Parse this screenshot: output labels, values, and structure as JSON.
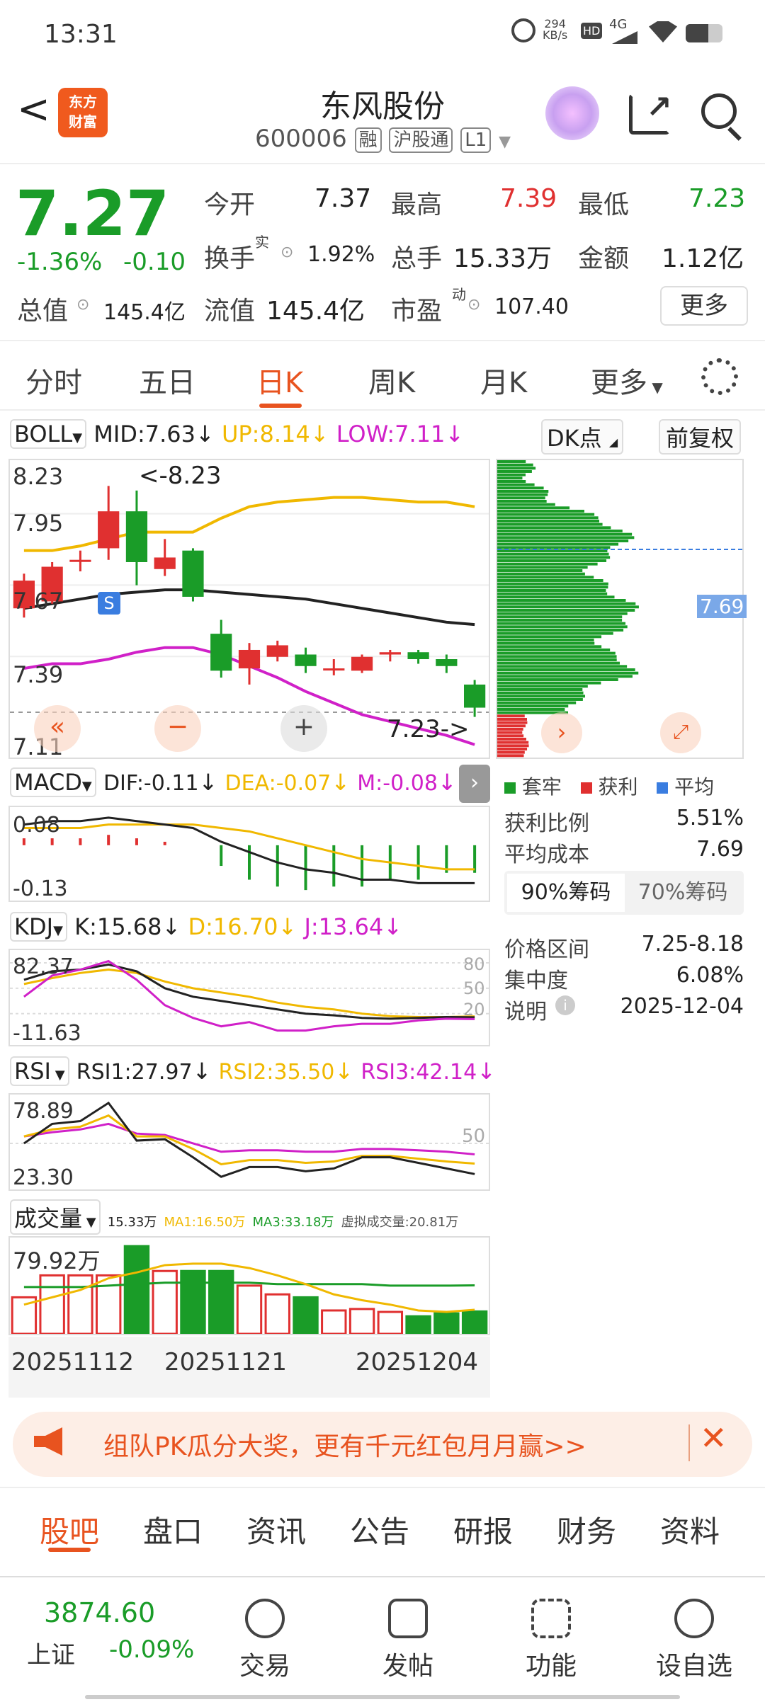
{
  "status": {
    "time": "13:31",
    "net_speed": "294",
    "net_unit": "KB/s",
    "hd": "HD",
    "signal": "4G"
  },
  "header": {
    "back": "<",
    "logo_line1": "东方",
    "logo_line2": "财富",
    "name": "东风股份",
    "code": "600006",
    "tag_rong": "融",
    "tag_hgt": "沪股通",
    "tag_level": "L1"
  },
  "quote": {
    "price": "7.27",
    "change_pct": "-1.36%",
    "change": "-0.10",
    "open_label": "今开",
    "open": "7.37",
    "high_label": "最高",
    "high": "7.39",
    "low_label": "最低",
    "low": "7.23",
    "turnover_label": "换手",
    "turnover_sup": "实",
    "turnover": "1.92%",
    "volume_label": "总手",
    "volume": "15.33万",
    "amount_label": "金额",
    "amount": "1.12亿",
    "total_cap_label": "总值",
    "total_cap": "145.4亿",
    "float_cap_label": "流值",
    "float_cap": "145.4亿",
    "pe_label": "市盈",
    "pe_sup": "动",
    "pe": "107.40",
    "more": "更多"
  },
  "tabs": [
    "分时",
    "五日",
    "日K",
    "周K",
    "月K",
    "更多"
  ],
  "boll": {
    "selector": "BOLL",
    "mid": "MID:7.63",
    "up": "UP:8.14",
    "low": "LOW:7.11",
    "arrow": "↓"
  },
  "kline": {
    "axis": [
      "8.23",
      "7.95",
      "7.67",
      "7.39",
      "7.11"
    ],
    "max_label": "<-8.23",
    "min_label": "7.23->",
    "s_mark": "S",
    "candles": [
      {
        "o": 7.7,
        "c": 7.82,
        "h": 7.85,
        "l": 7.66
      },
      {
        "o": 7.73,
        "c": 7.88,
        "h": 7.9,
        "l": 7.72
      },
      {
        "o": 7.91,
        "c": 7.91,
        "h": 7.95,
        "l": 7.86
      },
      {
        "o": 7.96,
        "c": 8.12,
        "h": 8.23,
        "l": 7.91
      },
      {
        "o": 8.12,
        "c": 7.9,
        "h": 8.21,
        "l": 7.8
      },
      {
        "o": 7.87,
        "c": 7.92,
        "h": 8.0,
        "l": 7.84
      },
      {
        "o": 7.95,
        "c": 7.75,
        "h": 7.96,
        "l": 7.73
      },
      {
        "o": 7.59,
        "c": 7.43,
        "h": 7.65,
        "l": 7.4
      },
      {
        "o": 7.44,
        "c": 7.52,
        "h": 7.55,
        "l": 7.37
      },
      {
        "o": 7.49,
        "c": 7.54,
        "h": 7.56,
        "l": 7.47
      },
      {
        "o": 7.5,
        "c": 7.45,
        "h": 7.53,
        "l": 7.42
      },
      {
        "o": 7.44,
        "c": 7.44,
        "h": 7.48,
        "l": 7.41
      },
      {
        "o": 7.43,
        "c": 7.49,
        "h": 7.5,
        "l": 7.42
      },
      {
        "o": 7.5,
        "c": 7.51,
        "h": 7.52,
        "l": 7.47
      },
      {
        "o": 7.51,
        "c": 7.48,
        "h": 7.52,
        "l": 7.46
      },
      {
        "o": 7.48,
        "c": 7.45,
        "h": 7.5,
        "l": 7.42
      },
      {
        "o": 7.37,
        "c": 7.27,
        "h": 7.39,
        "l": 7.23
      }
    ],
    "up_line": [
      7.95,
      7.95,
      7.97,
      8.0,
      8.03,
      8.03,
      8.03,
      8.09,
      8.14,
      8.16,
      8.17,
      8.18,
      8.18,
      8.17,
      8.16,
      8.16,
      8.14
    ],
    "mid_line": [
      7.7,
      7.72,
      7.74,
      7.76,
      7.77,
      7.78,
      7.78,
      7.77,
      7.76,
      7.75,
      7.74,
      7.72,
      7.7,
      7.68,
      7.66,
      7.64,
      7.63
    ],
    "low_line": [
      7.44,
      7.46,
      7.46,
      7.48,
      7.51,
      7.53,
      7.53,
      7.5,
      7.45,
      7.4,
      7.34,
      7.29,
      7.24,
      7.21,
      7.18,
      7.15,
      7.11
    ]
  },
  "macd": {
    "selector": "MACD",
    "dif": "DIF:-0.11",
    "dea": "DEA:-0.07",
    "m": "M:-0.08",
    "axis": [
      "0.08",
      "-0.13"
    ],
    "dif_line": [
      0.06,
      0.07,
      0.07,
      0.08,
      0.07,
      0.06,
      0.05,
      0.01,
      -0.02,
      -0.05,
      -0.07,
      -0.08,
      -0.1,
      -0.1,
      -0.11,
      -0.11,
      -0.11
    ],
    "dea_line": [
      0.05,
      0.05,
      0.05,
      0.06,
      0.06,
      0.06,
      0.06,
      0.05,
      0.04,
      0.02,
      0.0,
      -0.02,
      -0.04,
      -0.05,
      -0.06,
      -0.07,
      -0.07
    ],
    "hist": [
      0.02,
      0.02,
      0.02,
      0.03,
      0.02,
      0.01,
      0.0,
      -0.06,
      -0.1,
      -0.12,
      -0.13,
      -0.12,
      -0.12,
      -0.1,
      -0.1,
      -0.08,
      -0.08
    ]
  },
  "kdj": {
    "selector": "KDJ",
    "k": "K:15.68",
    "d": "D:16.70",
    "j": "J:13.64",
    "axis": [
      "82.37",
      "-11.63"
    ],
    "levels": [
      "80",
      "50",
      "20"
    ],
    "k_line": [
      60,
      70,
      72,
      78,
      70,
      50,
      40,
      35,
      30,
      25,
      20,
      18,
      15,
      14,
      15,
      16,
      15.68
    ],
    "d_line": [
      55,
      62,
      68,
      72,
      68,
      58,
      50,
      45,
      40,
      33,
      28,
      25,
      20,
      17,
      16,
      16,
      16.7
    ],
    "j_line": [
      40,
      65,
      72,
      82,
      60,
      30,
      15,
      5,
      10,
      0,
      0,
      5,
      8,
      8,
      12,
      14,
      13.64
    ]
  },
  "rsi": {
    "selector": "RSI",
    "r1": "RSI1:27.97",
    "r2": "RSI2:35.50",
    "r3": "RSI3:42.14",
    "axis": [
      "78.89",
      "23.30"
    ],
    "level": "50",
    "r1_line": [
      50,
      64,
      66,
      79,
      52,
      53,
      40,
      26,
      33,
      33,
      30,
      32,
      40,
      40,
      36,
      32,
      27.97
    ],
    "r2_line": [
      55,
      60,
      62,
      70,
      55,
      55,
      46,
      35,
      38,
      38,
      36,
      37,
      41,
      41,
      39,
      37,
      35.5
    ],
    "r3_line": [
      55,
      58,
      60,
      64,
      57,
      56,
      50,
      44,
      45,
      45,
      44,
      44,
      46,
      46,
      45,
      44,
      42.14
    ]
  },
  "vol": {
    "selector": "成交量",
    "v": "15.33万",
    "ma1": "MA1:16.50万",
    "ma3": "MA3:33.18万",
    "virtual": "虚拟成交量:20.81万",
    "axis": "79.92万",
    "bars": [
      25,
      40,
      40,
      40,
      60,
      43,
      43,
      43,
      33,
      27,
      25,
      16,
      17,
      15,
      12,
      14,
      15.33
    ],
    "ma1_line": [
      20,
      25,
      30,
      38,
      42,
      47,
      48,
      48,
      45,
      40,
      34,
      27,
      23,
      20,
      16,
      15,
      16.5
    ],
    "ma3_line": [
      32,
      32,
      32,
      33,
      34,
      35,
      35,
      35,
      35,
      34,
      34,
      34,
      34,
      33,
      33,
      33,
      33.18
    ]
  },
  "dates": [
    "20251112",
    "20251121",
    "20251204"
  ],
  "chips": {
    "dk_label": "DK点",
    "fq_label": "前复权",
    "avg_price_tag": "7.69",
    "legend": [
      "套牢",
      "获利",
      "平均"
    ],
    "profit_ratio_label": "获利比例",
    "profit_ratio": "5.51%",
    "avg_cost_label": "平均成本",
    "avg_cost": "7.69",
    "tab90": "90%筹码",
    "tab70": "70%筹码",
    "range_label": "价格区间",
    "range": "7.25-8.18",
    "conc_label": "集中度",
    "conc": "6.08%",
    "note_label": "说明",
    "note": "2025-12-04"
  },
  "banner": {
    "text": "组队PK瓜分大奖，更有千元红包月月赢>>"
  },
  "bottom_tabs": [
    "股吧",
    "盘口",
    "资讯",
    "公告",
    "研报",
    "财务",
    "资料"
  ],
  "bottombar": {
    "index_value": "3874.60",
    "index_name": "上证",
    "index_change": "-0.09%",
    "items": [
      "交易",
      "发帖",
      "功能",
      "设自选"
    ]
  },
  "colors": {
    "red": "#e03030",
    "green": "#1a9c28",
    "accent": "#e8531f",
    "yellow": "#f0b800",
    "magenta": "#d020c8"
  }
}
